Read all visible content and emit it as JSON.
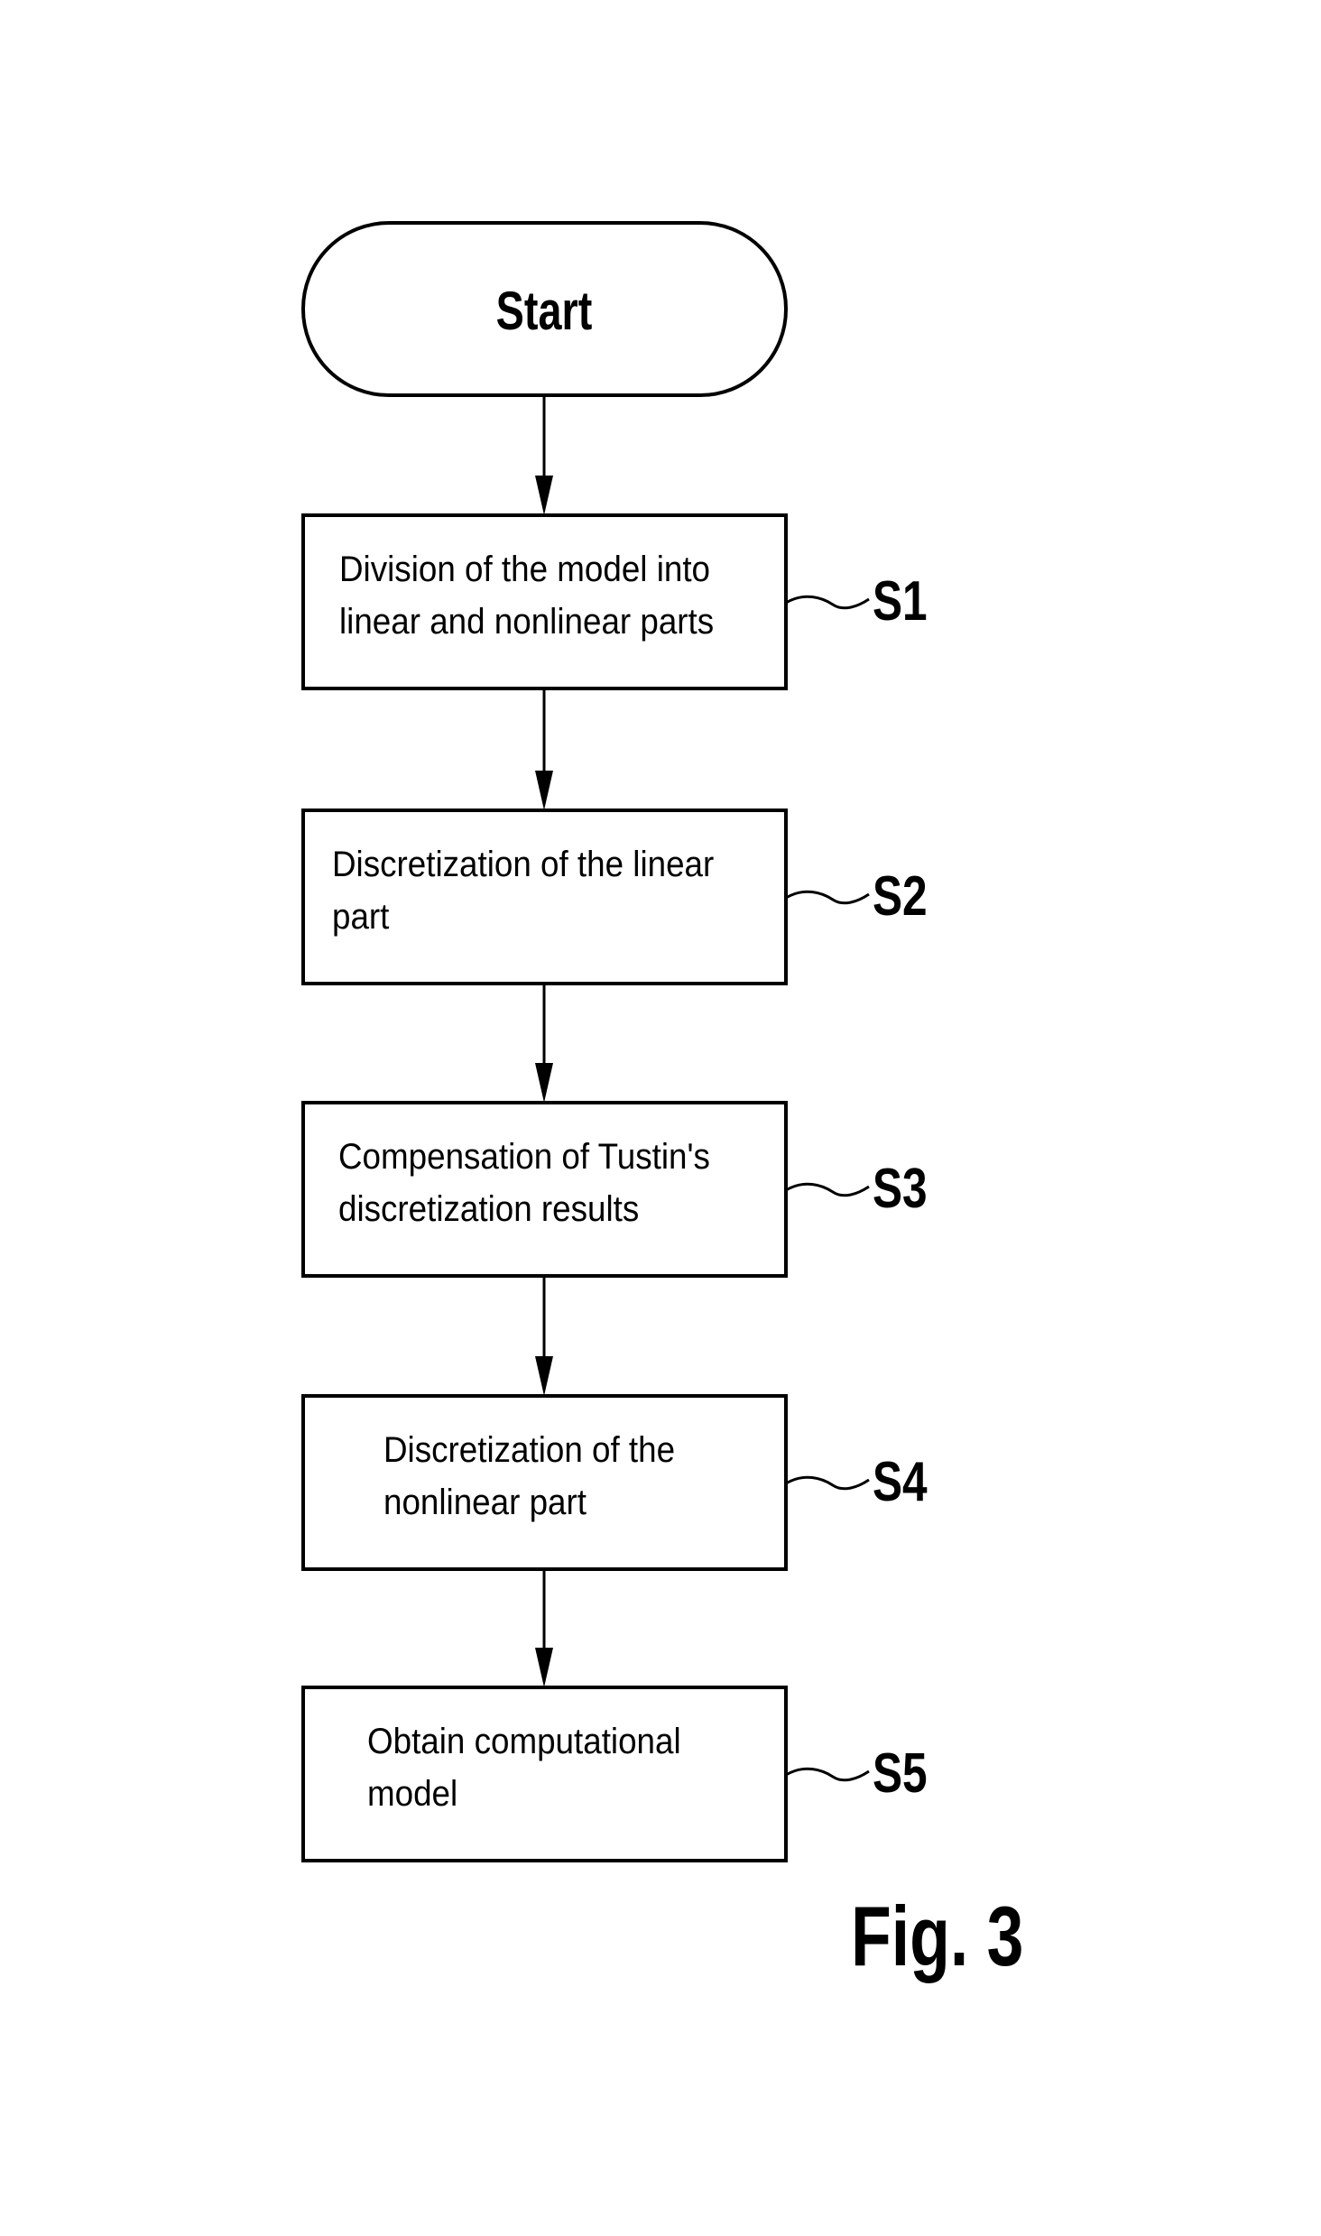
{
  "diagram": {
    "type": "flowchart",
    "start": {
      "label": "Start"
    },
    "steps": [
      {
        "id": "S1",
        "lines": [
          "Division of the model into",
          "linear and nonlinear parts"
        ]
      },
      {
        "id": "S2",
        "lines": [
          "Discretization of the linear",
          "part"
        ]
      },
      {
        "id": "S3",
        "lines": [
          "Compensation of Tustin's",
          "discretization results"
        ]
      },
      {
        "id": "S4",
        "lines": [
          "Discretization of the",
          "nonlinear part"
        ]
      },
      {
        "id": "S5",
        "lines": [
          "Obtain computational",
          "model"
        ]
      }
    ],
    "edges": [
      {
        "from": "Start",
        "to": "S1"
      },
      {
        "from": "S1",
        "to": "S2"
      },
      {
        "from": "S2",
        "to": "S3"
      },
      {
        "from": "S3",
        "to": "S4"
      },
      {
        "from": "S4",
        "to": "S5"
      }
    ],
    "figure_label": "Fig. 3"
  }
}
